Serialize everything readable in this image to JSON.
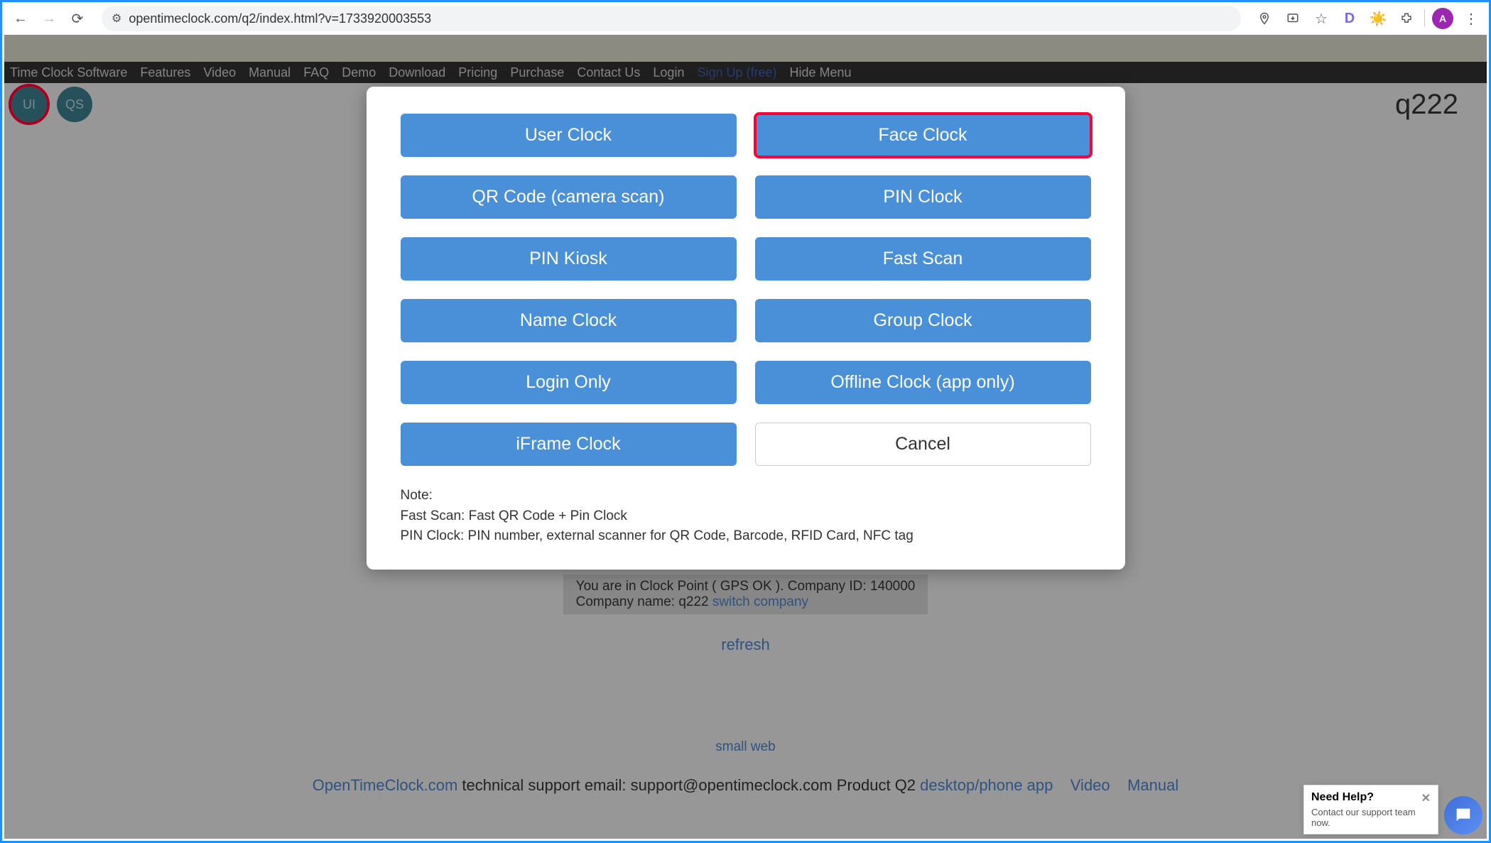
{
  "browser": {
    "url": "opentimeclock.com/q2/index.html?v=1733920003553",
    "avatar_letter": "A",
    "ext_d": "D"
  },
  "nav": {
    "items": [
      "Time Clock Software",
      "Features",
      "Video",
      "Manual",
      "FAQ",
      "Demo",
      "Download",
      "Pricing",
      "Purchase",
      "Contact Us",
      "Login",
      "Sign Up (free)",
      "Hide Menu"
    ]
  },
  "subbar": {
    "ui_label": "UI",
    "qs_label": "QS",
    "company_name": "q222"
  },
  "under": {
    "clockpoint_line": "You are in Clock Point ( GPS OK ).  Company ID: 140000",
    "company_line_prefix": "Company name: q222  ",
    "switch_company": "switch company",
    "refresh": "refresh",
    "small_web": "small web",
    "footer_site": "OpenTimeClock.com",
    "footer_text": " technical support email: support@opentimeclock.com Product Q2   ",
    "footer_desktop": "desktop/phone app",
    "footer_video": "Video",
    "footer_manual": "Manual"
  },
  "modal": {
    "buttons_left": [
      "User Clock",
      "QR Code (camera scan)",
      "PIN Kiosk",
      "Name Clock",
      "Login Only",
      "iFrame Clock"
    ],
    "buttons_right": [
      "Face Clock",
      "PIN Clock",
      "Fast Scan",
      "Group Clock",
      "Offline Clock (app only)",
      "Cancel"
    ],
    "note_label": "Note:",
    "note_line1": "Fast Scan: Fast QR Code + Pin Clock",
    "note_line2": "PIN Clock: PIN number, external scanner for QR Code, Barcode, RFID Card, NFC tag"
  },
  "help": {
    "title": "Need Help?",
    "sub": "Contact our support team now."
  }
}
